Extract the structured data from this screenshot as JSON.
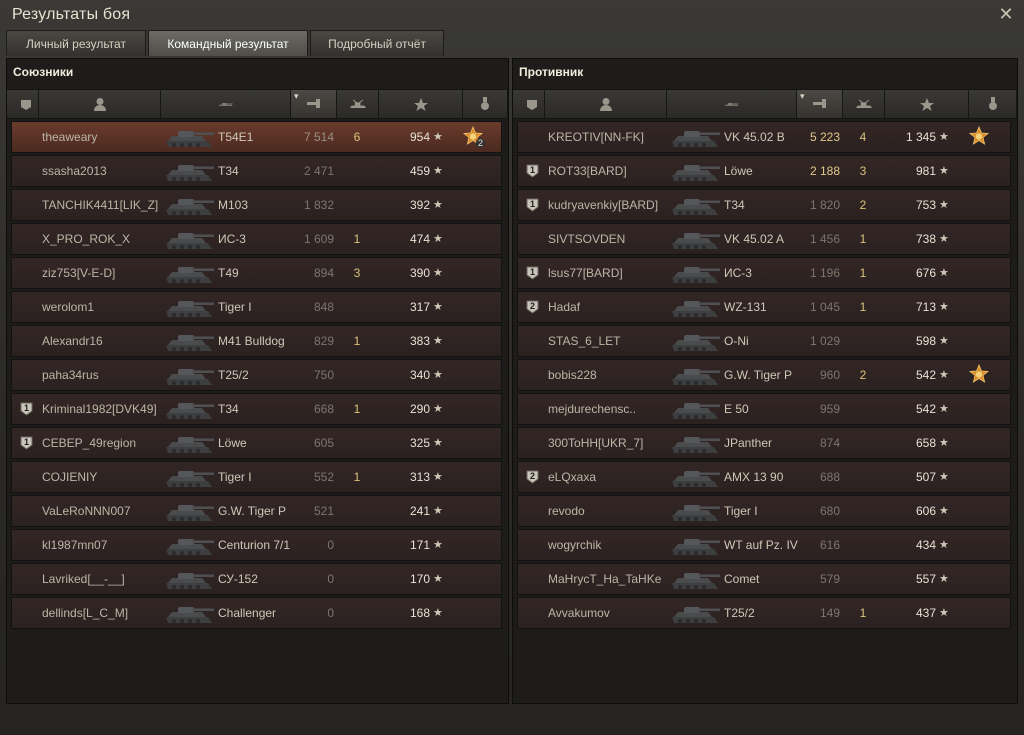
{
  "window": {
    "title": "Результаты боя",
    "close_label": "✕"
  },
  "tabs": [
    {
      "label": "Личный результат",
      "active": false
    },
    {
      "label": "Командный результат",
      "active": true
    },
    {
      "label": "Подробный отчёт",
      "active": false
    }
  ],
  "allies": {
    "title": "Союзники",
    "rows": [
      {
        "player": "theaweary",
        "tank": "T54E1",
        "xp": "7 514",
        "frags": "6",
        "points": "954",
        "me": true,
        "medal": true,
        "medal_count": "2"
      },
      {
        "player": "ssasha2013",
        "tank": "T34",
        "xp": "2 471",
        "frags": "",
        "points": "459"
      },
      {
        "player": "TANCHIK4411[LIK_Z]",
        "tank": "M103",
        "xp": "1 832",
        "frags": "",
        "points": "392"
      },
      {
        "player": "X_PRO_ROK_X",
        "tank": "ИС-3",
        "xp": "1 609",
        "frags": "1",
        "points": "474"
      },
      {
        "player": "ziz753[V-E-D]",
        "tank": "T49",
        "xp": "894",
        "frags": "3",
        "points": "390"
      },
      {
        "player": "werolom1",
        "tank": "Tiger I",
        "xp": "848",
        "frags": "",
        "points": "317"
      },
      {
        "player": "Alexandr16",
        "tank": "M41 Bulldog",
        "xp": "829",
        "frags": "1",
        "points": "383"
      },
      {
        "player": "paha34rus",
        "tank": "T25/2",
        "xp": "750",
        "frags": "",
        "points": "340"
      },
      {
        "player": "Kriminal1982[DVK49]",
        "tank": "T34",
        "xp": "668",
        "frags": "1",
        "points": "290",
        "clan": "1"
      },
      {
        "player": "CEBEP_49region",
        "tank": "Löwe",
        "xp": "605",
        "frags": "",
        "points": "325",
        "clan": "1"
      },
      {
        "player": "COJIENIY",
        "tank": "Tiger I",
        "xp": "552",
        "frags": "1",
        "points": "313"
      },
      {
        "player": "VaLeRoNNN007",
        "tank": "G.W. Tiger P",
        "xp": "521",
        "frags": "",
        "points": "241"
      },
      {
        "player": "kl1987mn07",
        "tank": "Centurion 7/1",
        "xp": "0",
        "frags": "",
        "points": "171"
      },
      {
        "player": "Lavriked[__-__]",
        "tank": "СУ-152",
        "xp": "0",
        "frags": "",
        "points": "170"
      },
      {
        "player": "dellinds[L_C_M]",
        "tank": "Challenger",
        "xp": "0",
        "frags": "",
        "points": "168"
      }
    ]
  },
  "enemies": {
    "title": "Противник",
    "rows": [
      {
        "player": "KREOTIV[NN-FK]",
        "tank": "VK 45.02 B",
        "xp": "5 223",
        "frags": "4",
        "points": "1 345",
        "medal": true,
        "xp_highlight": true
      },
      {
        "player": "ROT33[BARD]",
        "tank": "Löwe",
        "xp": "2 188",
        "frags": "3",
        "points": "981",
        "clan": "1",
        "xp_highlight": true
      },
      {
        "player": "kudryavenkiy[BARD]",
        "tank": "T34",
        "xp": "1 820",
        "frags": "2",
        "points": "753",
        "clan": "1"
      },
      {
        "player": "SIVTSOVDEN",
        "tank": "VK 45.02 A",
        "xp": "1 456",
        "frags": "1",
        "points": "738"
      },
      {
        "player": "lsus77[BARD]",
        "tank": "ИС-3",
        "xp": "1 196",
        "frags": "1",
        "points": "676",
        "clan": "1"
      },
      {
        "player": "Hadaf",
        "tank": "WZ-131",
        "xp": "1 045",
        "frags": "1",
        "points": "713",
        "clan": "2"
      },
      {
        "player": "STAS_6_LET",
        "tank": "O-Ni",
        "xp": "1 029",
        "frags": "",
        "points": "598"
      },
      {
        "player": "bobis228",
        "tank": "G.W. Tiger P",
        "xp": "960",
        "frags": "2",
        "points": "542",
        "medal": true
      },
      {
        "player": "mejdurechensc..",
        "tank": "E 50",
        "xp": "959",
        "frags": "",
        "points": "542"
      },
      {
        "player": "300ToHH[UKR_7]",
        "tank": "JPanther",
        "xp": "874",
        "frags": "",
        "points": "658"
      },
      {
        "player": "eLQxaxa",
        "tank": "AMX 13 90",
        "xp": "688",
        "frags": "",
        "points": "507",
        "clan": "2"
      },
      {
        "player": "revodo",
        "tank": "Tiger I",
        "xp": "680",
        "frags": "",
        "points": "606"
      },
      {
        "player": "wogyrchik",
        "tank": "WT auf Pz. IV",
        "xp": "616",
        "frags": "",
        "points": "434"
      },
      {
        "player": "MaHrycT_Ha_TaHKe",
        "tank": "Comet",
        "xp": "579",
        "frags": "",
        "points": "557"
      },
      {
        "player": "Avvakumov",
        "tank": "T25/2",
        "xp": "149",
        "frags": "1",
        "points": "437"
      }
    ]
  },
  "star": "★"
}
